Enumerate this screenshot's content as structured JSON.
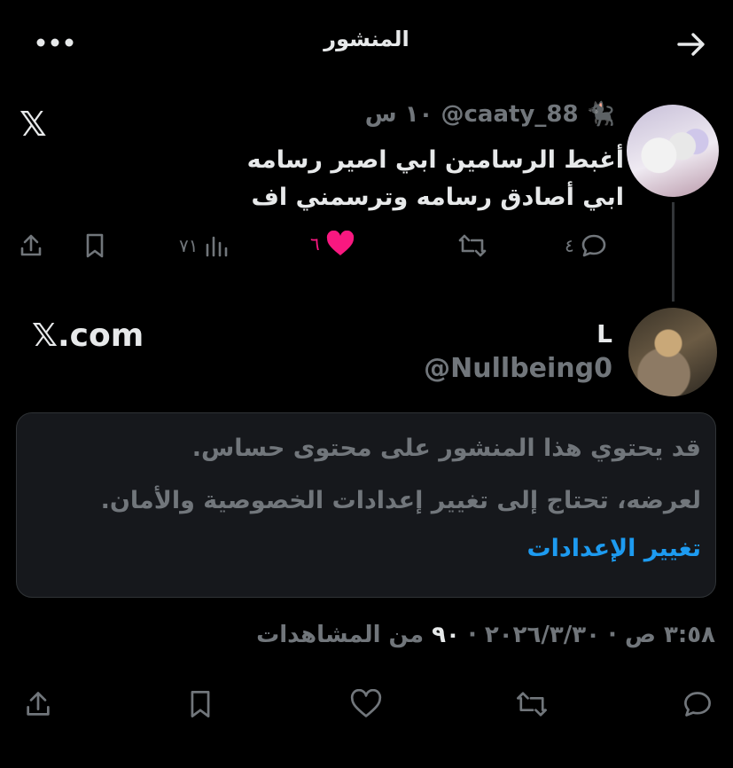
{
  "header": {
    "title": "المنشور"
  },
  "tweet": {
    "emoji": "🐈‍⬛",
    "handle": "@caaty_88",
    "time": "١٠ س",
    "line1": "أغبط الرسامين ابي اصير رسامه",
    "line2": "ابي أصادق رسامه وترسمني اف",
    "x_logo": "𝕏",
    "actions": {
      "replies": "٤",
      "likes": "٦",
      "views": "٧١"
    },
    "colors": {
      "like": "#f91880"
    }
  },
  "quoted": {
    "name": "L",
    "handle": "@Nullbeing0",
    "source": "𝕏.com"
  },
  "sensitive": {
    "line1": "قد يحتوي هذا المنشور على محتوى حساس.",
    "line2": "لعرضه، تحتاج إلى تغيير إعدادات الخصوصية والأمان.",
    "link": "تغيير الإعدادات",
    "link_color": "#1d9bf0"
  },
  "meta": {
    "datetime": "٣:٥٨ ص · ٢٠٢٦/٣/٣٠",
    "views_count": "٩٠",
    "views_label": "من المشاهدات"
  },
  "icons": [
    "more-icon",
    "back-arrow-icon",
    "share-icon",
    "bookmark-icon",
    "views-icon",
    "heart-icon",
    "retweet-icon",
    "reply-icon"
  ]
}
